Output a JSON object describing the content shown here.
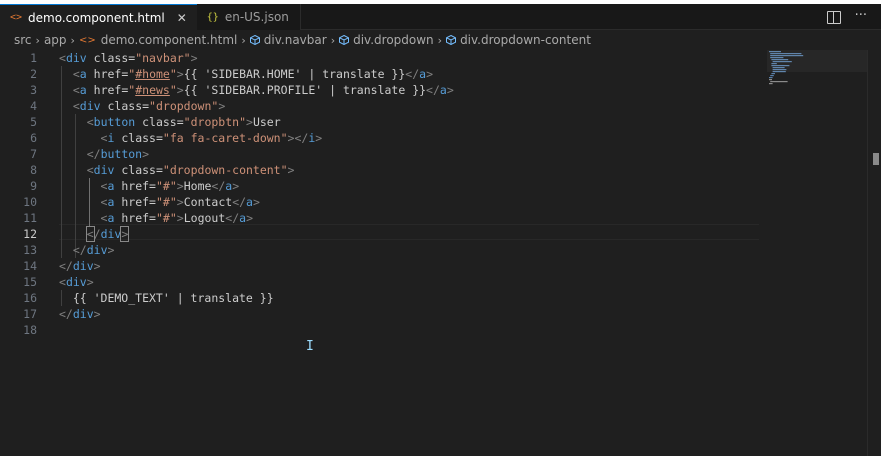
{
  "tabs": [
    {
      "icon": "<>",
      "label": "demo.component.html",
      "close": "✕"
    },
    {
      "icon": "{}",
      "label": "en-US.json"
    }
  ],
  "actions": {
    "more": "···"
  },
  "breadcrumb": [
    "src",
    "app",
    "demo.component.html",
    "div.navbar",
    "div.dropdown",
    "div.dropdown-content"
  ],
  "editor": {
    "current_line": 12,
    "line_numbers": [
      "1",
      "2",
      "3",
      "4",
      "5",
      "6",
      "7",
      "8",
      "9",
      "10",
      "11",
      "12",
      "13",
      "14",
      "15",
      "16",
      "17",
      "18"
    ],
    "lines": [
      "<div class=\"navbar\">",
      "  <a href=\"#home\">{{ 'SIDEBAR.HOME' | translate }}</a>",
      "  <a href=\"#news\">{{ 'SIDEBAR.PROFILE' | translate }}</a>",
      "  <div class=\"dropdown\">",
      "    <button class=\"dropbtn\">User",
      "      <i class=\"fa fa-caret-down\"></i>",
      "    </button>",
      "    <div class=\"dropdown-content\">",
      "      <a href=\"#\">Home</a>",
      "      <a href=\"#\">Contact</a>",
      "      <a href=\"#\">Logout</a>",
      "    </div>",
      "  </div>",
      "</div>",
      "<div>",
      "  {{ 'DEMO_TEXT' | translate }}",
      "</div>",
      ""
    ]
  },
  "colors": {
    "accent": "#0078d4",
    "tag": "#569cd6",
    "attribute": "#9cdcfe",
    "string": "#ce9178",
    "punctuation": "#808080",
    "background": "#1f1f1f"
  }
}
